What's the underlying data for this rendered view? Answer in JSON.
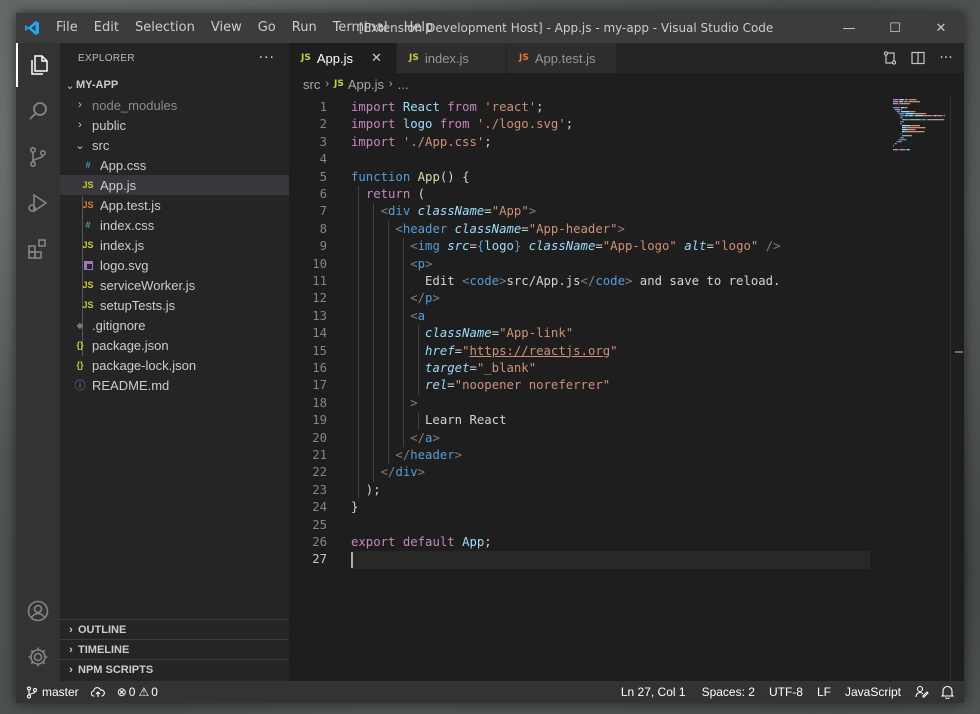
{
  "window": {
    "title": "[Extension Development Host] - App.js - my-app - Visual Studio Code",
    "menu": [
      "File",
      "Edit",
      "Selection",
      "View",
      "Go",
      "Run",
      "Terminal",
      "Help"
    ],
    "controls": {
      "minimize": "—",
      "maximize": "☐",
      "close": "✕"
    }
  },
  "activity_bar": [
    "explorer-icon",
    "search-icon",
    "source-control-icon",
    "run-debug-icon",
    "extensions-icon",
    "account-icon",
    "settings-gear-icon"
  ],
  "sidebar": {
    "title": "EXPLORER",
    "more": "···",
    "root": "MY-APP",
    "items": [
      {
        "label": "node_modules",
        "kind": "folder"
      },
      {
        "label": "public",
        "kind": "folder"
      },
      {
        "label": "src",
        "kind": "folder-open"
      },
      {
        "label": "App.css",
        "kind": "css"
      },
      {
        "label": "App.js",
        "kind": "js"
      },
      {
        "label": "App.test.js",
        "kind": "test"
      },
      {
        "label": "index.css",
        "kind": "css"
      },
      {
        "label": "index.js",
        "kind": "js"
      },
      {
        "label": "logo.svg",
        "kind": "svg"
      },
      {
        "label": "serviceWorker.js",
        "kind": "js"
      },
      {
        "label": "setupTests.js",
        "kind": "js"
      },
      {
        "label": ".gitignore",
        "kind": "git"
      },
      {
        "label": "package.json",
        "kind": "json"
      },
      {
        "label": "package-lock.json",
        "kind": "json"
      },
      {
        "label": "README.md",
        "kind": "info"
      }
    ],
    "panels": [
      "OUTLINE",
      "TIMELINE",
      "NPM SCRIPTS"
    ],
    "icons": {
      "js": "JS",
      "css": "#",
      "json": "{}",
      "info": "ⓘ",
      "git": "◆",
      "test": "JS"
    }
  },
  "tabs": [
    {
      "label": "App.js",
      "icon": "JS",
      "close": "✕"
    },
    {
      "label": "index.js",
      "icon": "JS"
    },
    {
      "label": "App.test.js",
      "icon": "JS"
    }
  ],
  "breadcrumb": {
    "folder": "src",
    "file": "App.js",
    "more": "..."
  },
  "editor": {
    "lines": [
      [
        [
          "k",
          "import"
        ],
        [
          "tx",
          " "
        ],
        [
          "v",
          "React"
        ],
        [
          "tx",
          " "
        ],
        [
          "k",
          "from"
        ],
        [
          "tx",
          " "
        ],
        [
          "s",
          "'react'"
        ],
        [
          "tx",
          ";"
        ]
      ],
      [
        [
          "k",
          "import"
        ],
        [
          "tx",
          " "
        ],
        [
          "v",
          "logo"
        ],
        [
          "tx",
          " "
        ],
        [
          "k",
          "from"
        ],
        [
          "tx",
          " "
        ],
        [
          "s",
          "'./logo.svg'"
        ],
        [
          "tx",
          ";"
        ]
      ],
      [
        [
          "k",
          "import"
        ],
        [
          "tx",
          " "
        ],
        [
          "s",
          "'./App.css'"
        ],
        [
          "tx",
          ";"
        ]
      ],
      [],
      [
        [
          "kw",
          "function"
        ],
        [
          "tx",
          " "
        ],
        [
          "f",
          "App"
        ],
        [
          "tx",
          "() {"
        ]
      ],
      [
        [
          "tx",
          "  "
        ],
        [
          "k",
          "return"
        ],
        [
          "tx",
          " ("
        ]
      ],
      [
        [
          "tx",
          "    "
        ],
        [
          "p",
          "<"
        ],
        [
          "t",
          "div"
        ],
        [
          "tx",
          " "
        ],
        [
          "a",
          "className"
        ],
        [
          "tx",
          "="
        ],
        [
          "s",
          "\"App\""
        ],
        [
          "p",
          ">"
        ]
      ],
      [
        [
          "tx",
          "      "
        ],
        [
          "p",
          "<"
        ],
        [
          "t",
          "header"
        ],
        [
          "tx",
          " "
        ],
        [
          "a",
          "className"
        ],
        [
          "tx",
          "="
        ],
        [
          "s",
          "\"App-header\""
        ],
        [
          "p",
          ">"
        ]
      ],
      [
        [
          "tx",
          "        "
        ],
        [
          "p",
          "<"
        ],
        [
          "t",
          "img"
        ],
        [
          "tx",
          " "
        ],
        [
          "a",
          "src"
        ],
        [
          "tx",
          "="
        ],
        [
          "kw",
          "{"
        ],
        [
          "v",
          "logo"
        ],
        [
          "kw",
          "}"
        ],
        [
          "tx",
          " "
        ],
        [
          "a",
          "className"
        ],
        [
          "tx",
          "="
        ],
        [
          "s",
          "\"App-logo\""
        ],
        [
          "tx",
          " "
        ],
        [
          "a",
          "alt"
        ],
        [
          "tx",
          "="
        ],
        [
          "s",
          "\"logo\""
        ],
        [
          "tx",
          " "
        ],
        [
          "p",
          "/>"
        ]
      ],
      [
        [
          "tx",
          "        "
        ],
        [
          "p",
          "<"
        ],
        [
          "t",
          "p"
        ],
        [
          "p",
          ">"
        ]
      ],
      [
        [
          "tx",
          "          Edit "
        ],
        [
          "p",
          "<"
        ],
        [
          "t",
          "code"
        ],
        [
          "p",
          ">"
        ],
        [
          "tx",
          "src/App.js"
        ],
        [
          "p",
          "</"
        ],
        [
          "t",
          "code"
        ],
        [
          "p",
          ">"
        ],
        [
          "tx",
          " and save to reload."
        ]
      ],
      [
        [
          "tx",
          "        "
        ],
        [
          "p",
          "</"
        ],
        [
          "t",
          "p"
        ],
        [
          "p",
          ">"
        ]
      ],
      [
        [
          "tx",
          "        "
        ],
        [
          "p",
          "<"
        ],
        [
          "t",
          "a"
        ]
      ],
      [
        [
          "tx",
          "          "
        ],
        [
          "a",
          "className"
        ],
        [
          "tx",
          "="
        ],
        [
          "s",
          "\"App-link\""
        ]
      ],
      [
        [
          "tx",
          "          "
        ],
        [
          "a",
          "href"
        ],
        [
          "tx",
          "="
        ],
        [
          "s",
          "\""
        ],
        [
          "su",
          "https://reactjs.org"
        ],
        [
          "s",
          "\""
        ]
      ],
      [
        [
          "tx",
          "          "
        ],
        [
          "a",
          "target"
        ],
        [
          "tx",
          "="
        ],
        [
          "s",
          "\"_blank\""
        ]
      ],
      [
        [
          "tx",
          "          "
        ],
        [
          "a",
          "rel"
        ],
        [
          "tx",
          "="
        ],
        [
          "s",
          "\"noopener noreferrer\""
        ]
      ],
      [
        [
          "tx",
          "        "
        ],
        [
          "p",
          ">"
        ]
      ],
      [
        [
          "tx",
          "          Learn React"
        ]
      ],
      [
        [
          "tx",
          "        "
        ],
        [
          "p",
          "</"
        ],
        [
          "t",
          "a"
        ],
        [
          "p",
          ">"
        ]
      ],
      [
        [
          "tx",
          "      "
        ],
        [
          "p",
          "</"
        ],
        [
          "t",
          "header"
        ],
        [
          "p",
          ">"
        ]
      ],
      [
        [
          "tx",
          "    "
        ],
        [
          "p",
          "</"
        ],
        [
          "t",
          "div"
        ],
        [
          "p",
          ">"
        ]
      ],
      [
        [
          "tx",
          "  );"
        ]
      ],
      [
        [
          "tx",
          "}"
        ]
      ],
      [],
      [
        [
          "k",
          "export"
        ],
        [
          "tx",
          " "
        ],
        [
          "k",
          "default"
        ],
        [
          "tx",
          " "
        ],
        [
          "v",
          "App"
        ],
        [
          "tx",
          ";"
        ]
      ],
      []
    ],
    "current_line": 27
  },
  "statusbar": {
    "branch": "master",
    "errors": "0",
    "warnings": "0",
    "position": "Ln 27, Col 1",
    "spaces": "Spaces: 2",
    "encoding": "UTF-8",
    "eol": "LF",
    "language": "JavaScript"
  },
  "colors": {
    "titlebar": "#3c3c3c",
    "activitybar": "#333333",
    "sidebar": "#252526",
    "editor": "#1e1e1e",
    "statusbar": "#333333",
    "js_icon": "#cbcb41",
    "css_icon": "#519aba",
    "json_icon": "#cbcb41"
  }
}
